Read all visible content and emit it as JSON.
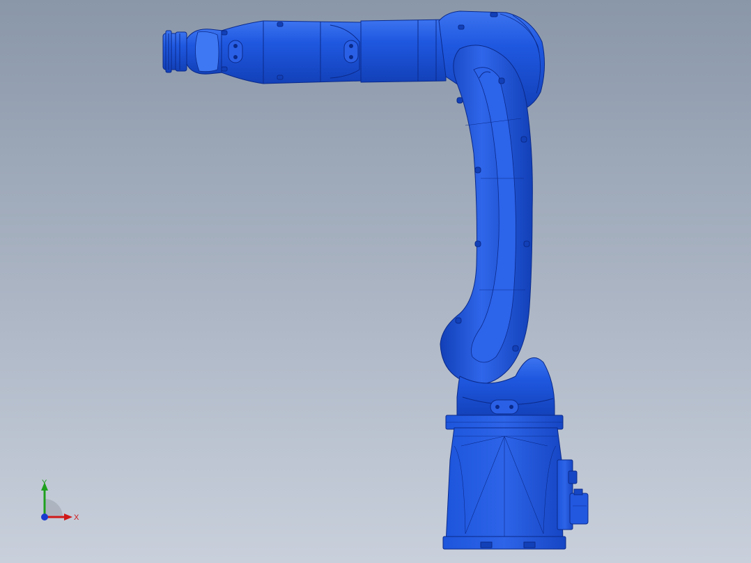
{
  "viewport": {
    "background_top": "#8a97a9",
    "background_bottom": "#c9d0dc"
  },
  "model": {
    "name": "robot-arm",
    "color": "#1a4fd6",
    "edge_color": "#0b2a8a",
    "highlight_color": "#3c74f0"
  },
  "triad": {
    "x_label": "X",
    "y_label": "Y",
    "x_color": "#d01818",
    "y_color": "#1ea01e",
    "z_color": "#1a3bd0"
  }
}
